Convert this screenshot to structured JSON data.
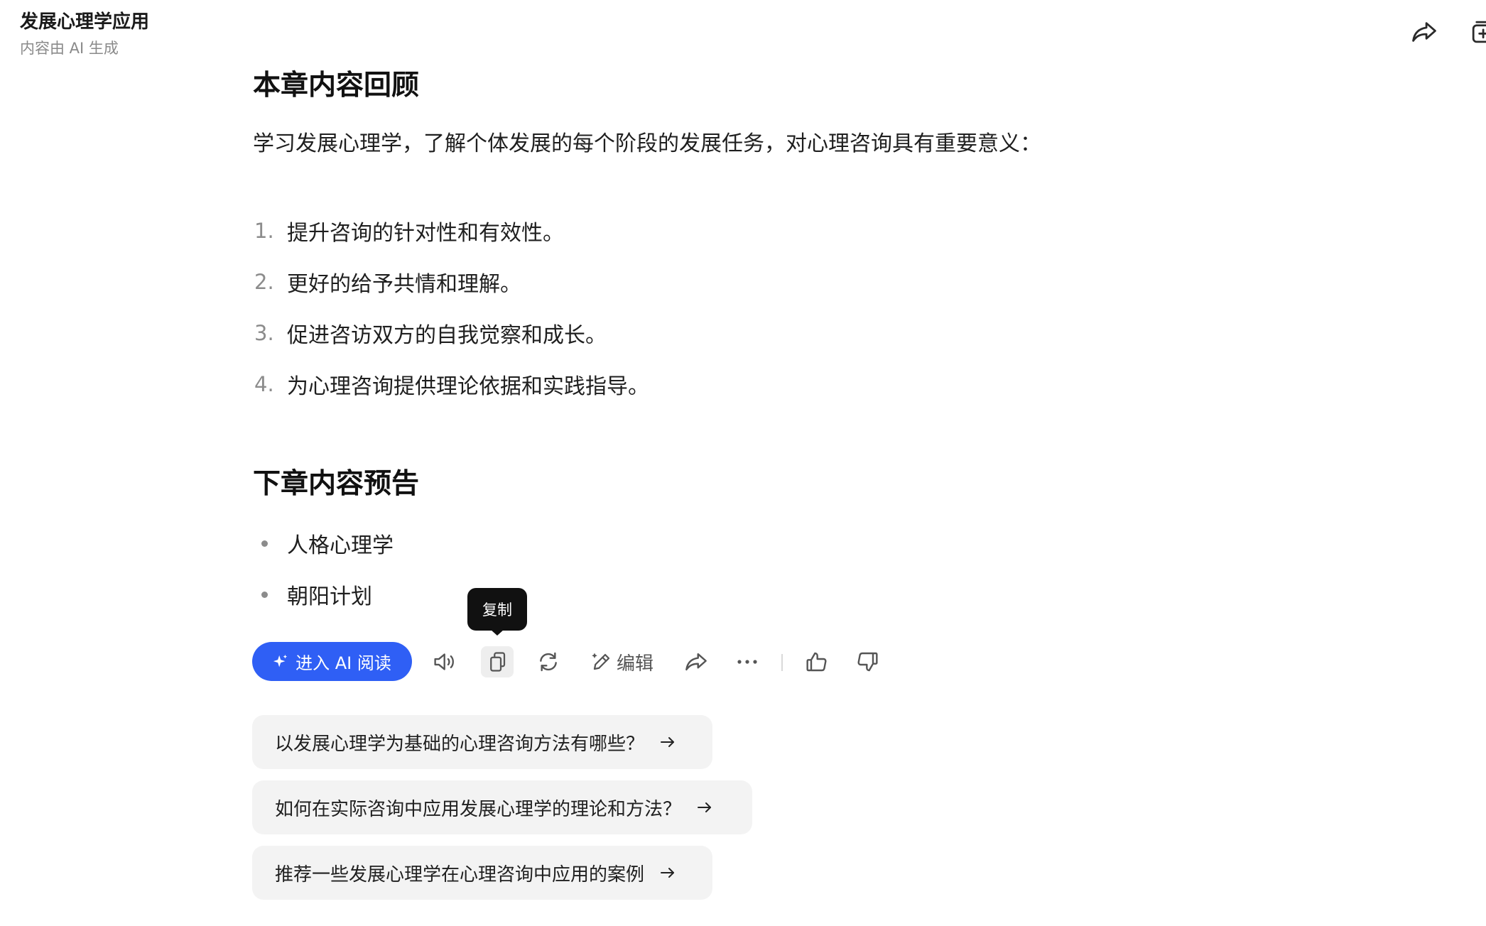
{
  "header": {
    "title": "发展心理学应用",
    "subtitle": "内容由 AI 生成"
  },
  "main": {
    "section1": {
      "heading": "本章内容回顾",
      "intro": "学习发展心理学，了解个体发展的每个阶段的发展任务，对心理咨询具有重要意义：",
      "items": [
        {
          "num": "1.",
          "text": "提升咨询的针对性和有效性。"
        },
        {
          "num": "2.",
          "text": "更好的给予共情和理解。"
        },
        {
          "num": "3.",
          "text": "促进咨访双方的自我觉察和成长。"
        },
        {
          "num": "4.",
          "text": "为心理咨询提供理论依据和实践指导。"
        }
      ]
    },
    "section2": {
      "heading": "下章内容预告",
      "items": [
        {
          "text": "人格心理学"
        },
        {
          "text": "朝阳计划"
        }
      ]
    }
  },
  "actions": {
    "ai_read_label": "进入 AI 阅读",
    "edit_label": "编辑",
    "tooltip": "复制",
    "icons": [
      "sparkle-icon",
      "speaker-icon",
      "copy-icon",
      "refresh-icon",
      "edit-icon",
      "share-icon",
      "more-icon",
      "thumbs-up-icon",
      "thumbs-down-icon"
    ]
  },
  "suggestions": [
    {
      "text": "以发展心理学为基础的心理咨询方法有哪些？"
    },
    {
      "text": "如何在实际咨询中应用发展心理学的理论和方法？"
    },
    {
      "text": "推荐一些发展心理学在心理咨询中应用的案例"
    }
  ],
  "colors": {
    "accent": "#2f5ff5",
    "tooltip_bg": "#111111",
    "suggestion_bg": "#f3f3f3"
  }
}
